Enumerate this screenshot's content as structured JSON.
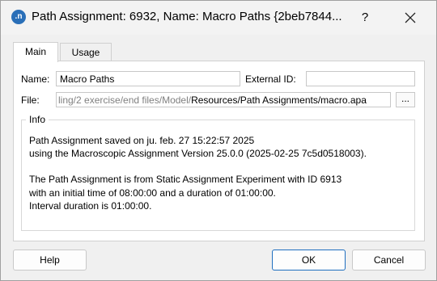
{
  "window": {
    "title": "Path Assignment: 6932, Name: Macro Paths  {2beb7844...",
    "app_icon_text": ".n",
    "help_label": "?"
  },
  "tabs": [
    {
      "label": "Main",
      "active": true
    },
    {
      "label": "Usage",
      "active": false
    }
  ],
  "form": {
    "name_label": "Name:",
    "name_value": "Macro Paths",
    "external_id_label": "External ID:",
    "external_id_value": "",
    "file_label": "File:",
    "file_value_gray": "ling/2 exercise/end files/Model/",
    "file_value_dark": "Resources/Path Assignments/macro.apa",
    "browse_label": "..."
  },
  "info": {
    "title": "Info",
    "lines": [
      "Path Assignment saved on ju. feb. 27 15:22:57 2025",
      "using the Macroscopic Assignment Version 25.0.0 (2025-02-25 7c5d0518003).",
      "",
      "The Path Assignment is from Static Assignment Experiment with ID 6913",
      "with an initial time of 08:00:00 and a duration of 01:00:00.",
      "Interval duration is 01:00:00."
    ]
  },
  "buttons": {
    "help": "Help",
    "ok": "OK",
    "cancel": "Cancel"
  },
  "colors": {
    "accent": "#1f6fbf",
    "app_icon": "#2a6fb8"
  }
}
